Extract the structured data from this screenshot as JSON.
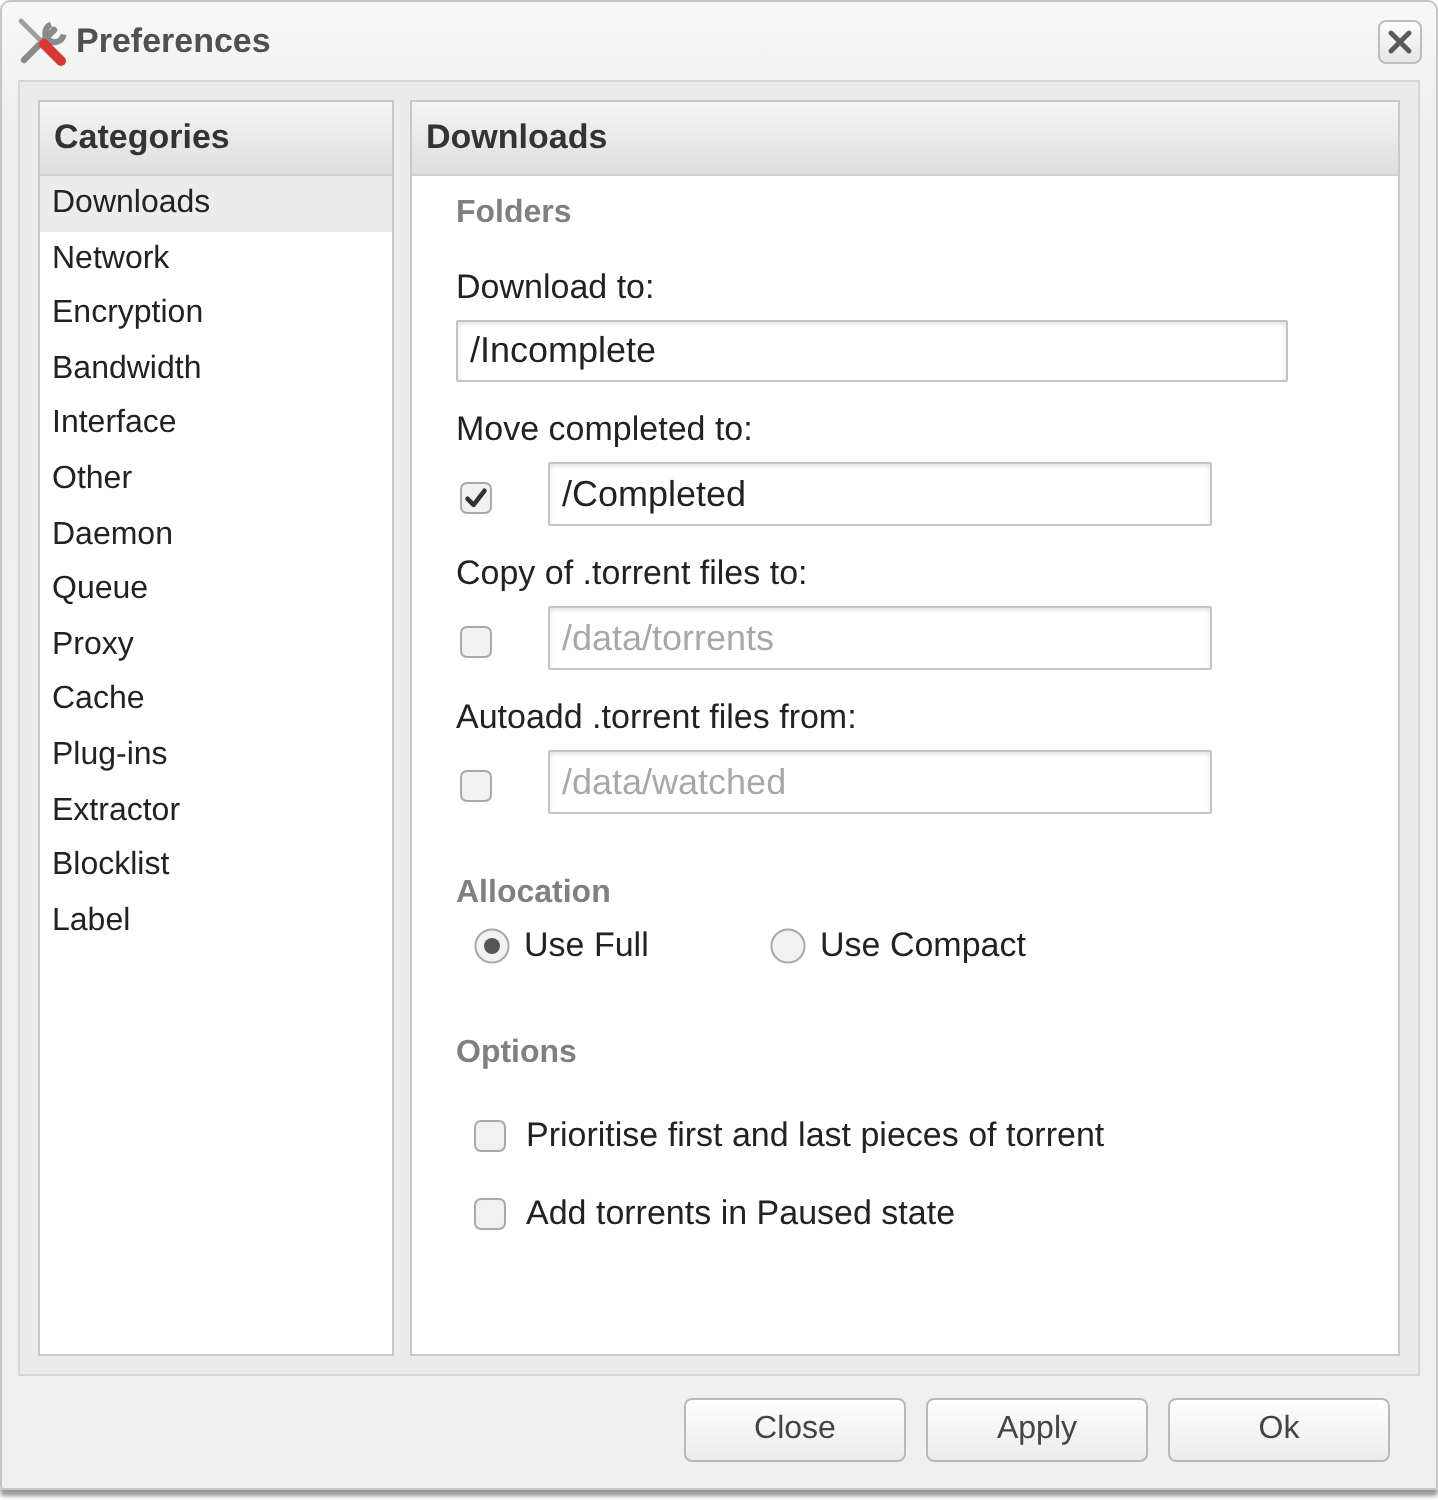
{
  "window": {
    "title": "Preferences"
  },
  "sidebar": {
    "title": "Categories",
    "items": [
      {
        "label": "Downloads",
        "selected": true
      },
      {
        "label": "Network",
        "selected": false
      },
      {
        "label": "Encryption",
        "selected": false
      },
      {
        "label": "Bandwidth",
        "selected": false
      },
      {
        "label": "Interface",
        "selected": false
      },
      {
        "label": "Other",
        "selected": false
      },
      {
        "label": "Daemon",
        "selected": false
      },
      {
        "label": "Queue",
        "selected": false
      },
      {
        "label": "Proxy",
        "selected": false
      },
      {
        "label": "Cache",
        "selected": false
      },
      {
        "label": "Plug-ins",
        "selected": false
      },
      {
        "label": "Extractor",
        "selected": false
      },
      {
        "label": "Blocklist",
        "selected": false
      },
      {
        "label": "Label",
        "selected": false
      }
    ]
  },
  "panel": {
    "title": "Downloads",
    "folders": {
      "title": "Folders",
      "fields": [
        {
          "kind": "text",
          "label": "Download to:",
          "value": "/Incomplete"
        },
        {
          "kind": "toggle",
          "label": "Move completed to:",
          "checked": true,
          "value": "/Completed"
        },
        {
          "kind": "toggle",
          "label": "Copy of .torrent files to:",
          "checked": false,
          "value": "/data/torrents"
        },
        {
          "kind": "toggle",
          "label": "Autoadd .torrent files from:",
          "checked": false,
          "value": "/data/watched"
        }
      ]
    },
    "allocation": {
      "title": "Allocation",
      "options": [
        {
          "label": "Use Full",
          "selected": true
        },
        {
          "label": "Use Compact",
          "selected": false
        }
      ]
    },
    "options": {
      "title": "Options",
      "items": [
        {
          "label": "Prioritise first and last pieces of torrent",
          "checked": false
        },
        {
          "label": "Add torrents in Paused state",
          "checked": false
        }
      ]
    }
  },
  "buttons": [
    "Close",
    "Apply",
    "Ok"
  ]
}
